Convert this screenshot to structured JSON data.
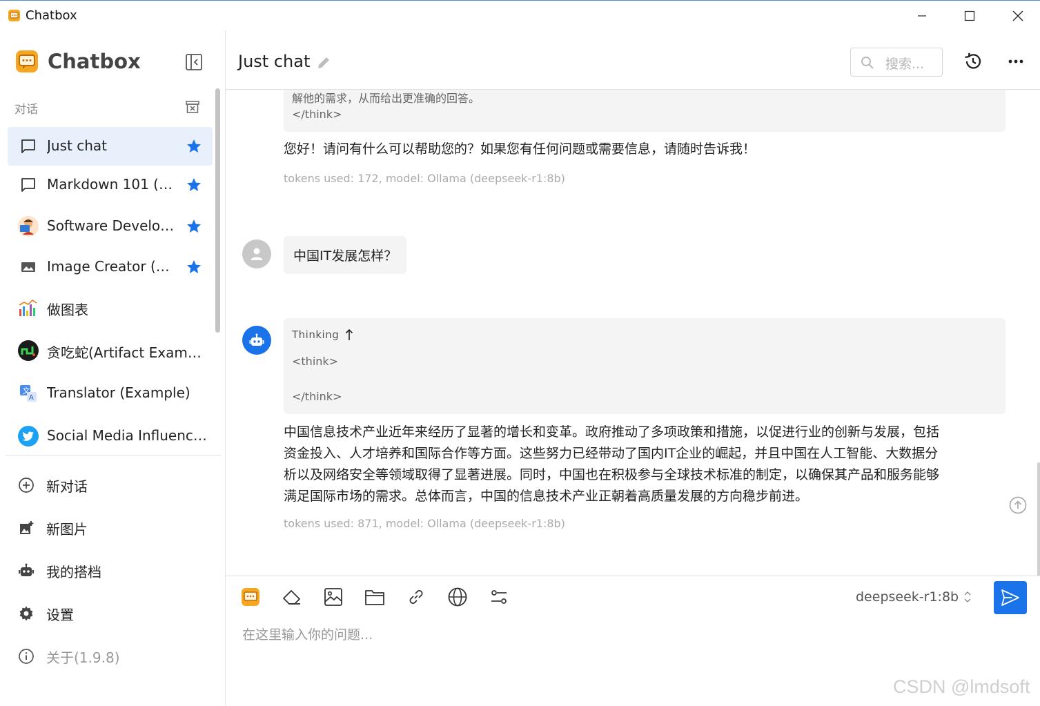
{
  "window": {
    "title": "Chatbox"
  },
  "sidebar": {
    "brand": "Chatbox",
    "section_label": "对话",
    "conversations": [
      {
        "label": "Just chat",
        "icon": "chat-bubble-icon",
        "starred": true,
        "active": true
      },
      {
        "label": "Markdown 101 (E…",
        "icon": "chat-bubble-icon",
        "starred": true
      },
      {
        "label": "Software Develop…",
        "icon": "developer-avatar-icon",
        "starred": true
      },
      {
        "label": "Image Creator (E…",
        "icon": "image-icon",
        "starred": true
      },
      {
        "label": "做图表",
        "icon": "chart-avatar-icon",
        "starred": false
      },
      {
        "label": "贪吃蛇(Artifact Example)",
        "icon": "snake-game-avatar-icon",
        "starred": false
      },
      {
        "label": "Translator (Example)",
        "icon": "translate-avatar-icon",
        "starred": false
      },
      {
        "label": "Social Media Influence…",
        "icon": "twitter-avatar-icon",
        "starred": false
      }
    ],
    "menu": [
      {
        "label": "新对话",
        "icon": "add-circle-icon"
      },
      {
        "label": "新图片",
        "icon": "add-photo-icon"
      },
      {
        "label": "我的搭档",
        "icon": "robot-icon"
      },
      {
        "label": "设置",
        "icon": "gear-icon"
      },
      {
        "label": "关于(1.9.8)",
        "icon": "info-icon"
      }
    ]
  },
  "header": {
    "title": "Just chat",
    "search_placeholder": "搜索..."
  },
  "messages": {
    "prev_think_line": "解他的需求，从而给出更准确的回答。",
    "prev_think_close": "</think>",
    "prev_reply": "您好！请问有什么可以帮助您的？如果您有任何问题或需要信息，请随时告诉我！",
    "prev_meta": "tokens used: 172, model: Ollama (deepseek-r1:8b)",
    "user_question": "中国IT发展怎样？",
    "thinking_label": "Thinking",
    "think_open": "<think>",
    "think_close": "</think>",
    "reply_lines": [
      "中国信息技术产业近年来经历了显著的增长和变革。政府推动了多项政策和措施，以促进行业的创新与发展，包括",
      "资金投入、人才培养和国际合作等方面。这些努力已经带动了国内IT企业的崛起，并且中国在人工智能、大数据分",
      "析以及网络安全等领域取得了显著进展。同时，中国也在积极参与全球技术标准的制定，以确保其产品和服务能够",
      "满足国际市场的需求。总体而言，中国的信息技术产业正朝着高质量发展的方向稳步前进。"
    ],
    "reply_meta": "tokens used: 871, model: Ollama (deepseek-r1:8b)"
  },
  "composer": {
    "model": "deepseek-r1:8b",
    "placeholder": "在这里输入你的问题..."
  },
  "watermark": "CSDN @lmdsoft",
  "colors": {
    "accent": "#1a73e8",
    "active_bg": "#e8f0fb"
  }
}
